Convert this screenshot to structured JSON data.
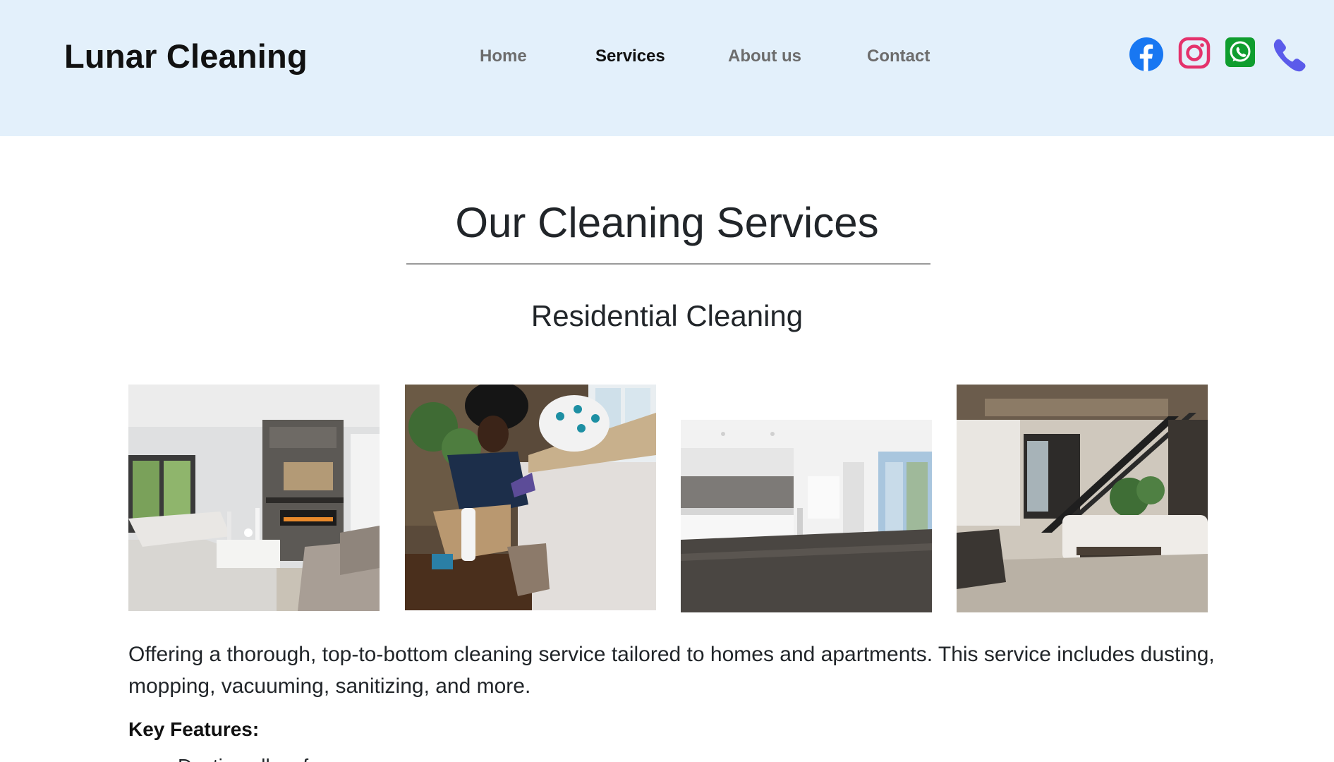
{
  "brand": "Lunar Cleaning",
  "nav": {
    "home": "Home",
    "services": "Services",
    "about": "About us",
    "contact": "Contact"
  },
  "social_icons": [
    "facebook-icon",
    "instagram-icon",
    "whatsapp-icon",
    "phone-icon"
  ],
  "colors": {
    "header_bg": "#e3f0fb",
    "facebook": "#1877f2",
    "instagram": "#e4326c",
    "whatsapp": "#0f9d2e",
    "phone": "#5b5bea"
  },
  "page": {
    "title": "Our Cleaning Services",
    "section_title": "Residential Cleaning",
    "description": "Offering a thorough, top-to-bottom cleaning service tailored to homes and apartments. This service includes dusting, mopping, vacuuming, sanitizing, and more.",
    "features_heading": "Key Features:",
    "features": [
      "Dusting all surfaces"
    ]
  }
}
